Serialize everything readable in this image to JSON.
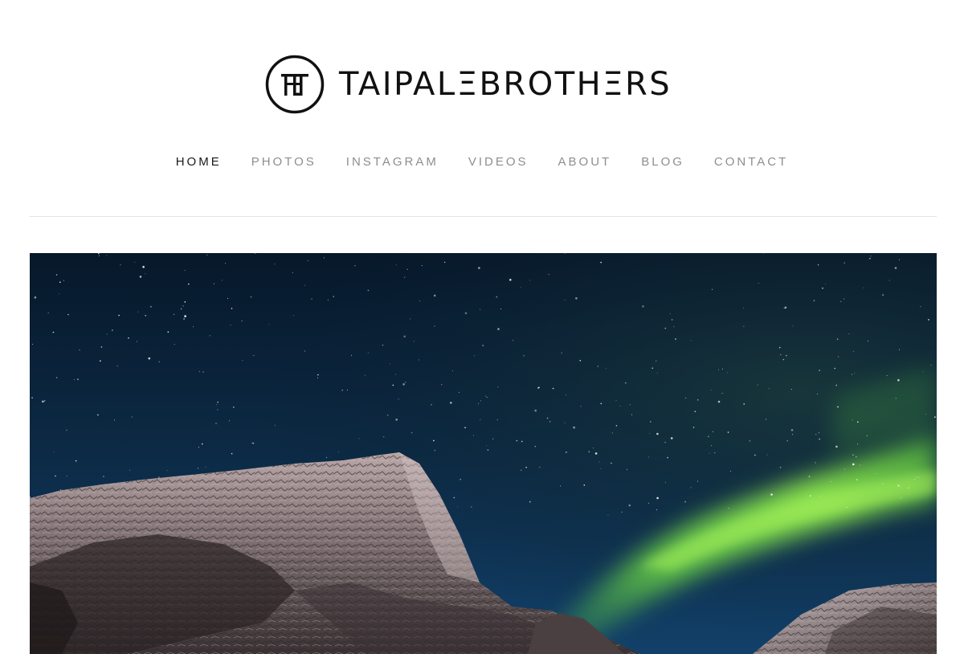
{
  "brand": {
    "name": "TAIPALΞBROTHΞRS",
    "logo_mark": "TB-monogram-circle-logo"
  },
  "nav": {
    "items": [
      {
        "label": "HOME",
        "active": true
      },
      {
        "label": "PHOTOS",
        "active": false
      },
      {
        "label": "INSTAGRAM",
        "active": false
      },
      {
        "label": "VIDEOS",
        "active": false
      },
      {
        "label": "ABOUT",
        "active": false
      },
      {
        "label": "BLOG",
        "active": false
      },
      {
        "label": "CONTACT",
        "active": false
      }
    ]
  },
  "hero": {
    "subject": "mountain-under-northern-lights-photo"
  },
  "colors": {
    "text_active": "#1a1a1a",
    "text_muted": "#8e8e8e",
    "divider": "#e3e3e3",
    "aurora": "#7fe04a",
    "sky": "#0b2238"
  }
}
